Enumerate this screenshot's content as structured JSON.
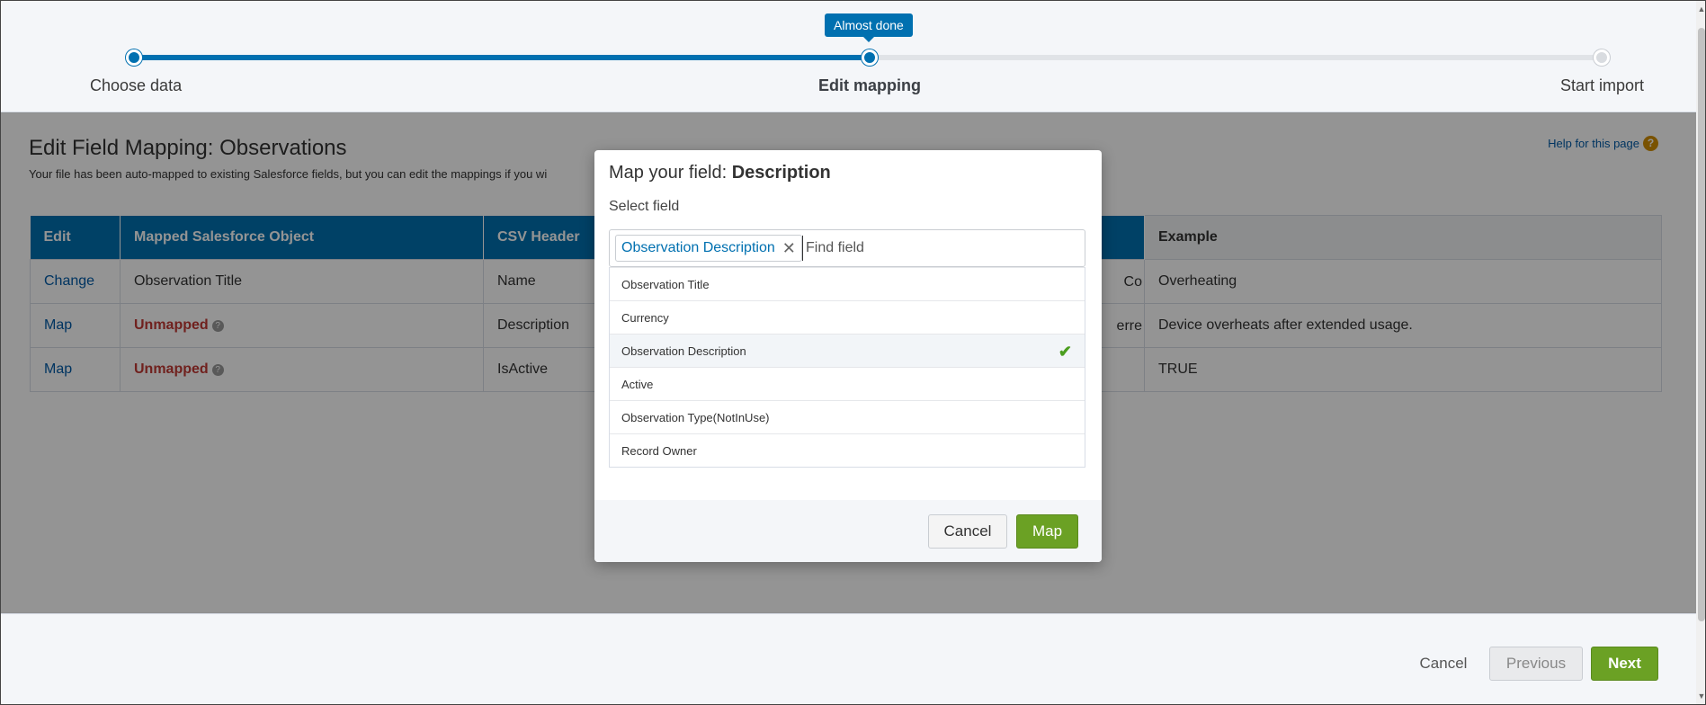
{
  "progress": {
    "bubble": "Almost done",
    "steps": [
      {
        "label": "Choose data",
        "state": "done"
      },
      {
        "label": "Edit mapping",
        "state": "current"
      },
      {
        "label": "Start import",
        "state": "todo"
      }
    ]
  },
  "page": {
    "title": "Edit Field Mapping: Observations",
    "description": "Your file has been auto-mapped to existing Salesforce fields, but you can edit the mappings if you wi",
    "help_link": "Help for this page",
    "help_icon": "question-icon"
  },
  "table": {
    "headers": [
      "Edit",
      "Mapped Salesforce Object",
      "CSV Header",
      "Example"
    ],
    "rows": [
      {
        "edit": "Change",
        "mapped": "Observation Title",
        "csv": "Name",
        "partial": "Co",
        "example": "Overheating"
      },
      {
        "edit": "Map",
        "mapped": "Unmapped",
        "csv": "Description",
        "partial": "erre",
        "example": "Device overheats after extended usage."
      },
      {
        "edit": "Map",
        "mapped": "Unmapped",
        "csv": "IsActive",
        "partial": "",
        "example": "TRUE"
      }
    ]
  },
  "modal": {
    "title_prefix": "Map your field: ",
    "title_field": "Description",
    "subtitle": "Select field",
    "selected_pill": "Observation Description",
    "search_placeholder": "Find field",
    "options": [
      {
        "label": "Observation Title",
        "selected": false
      },
      {
        "label": "Currency",
        "selected": false
      },
      {
        "label": "Observation Description",
        "selected": true
      },
      {
        "label": "Active",
        "selected": false
      },
      {
        "label": "Observation Type(NotInUse)",
        "selected": false
      },
      {
        "label": "Record Owner",
        "selected": false
      }
    ],
    "cancel_label": "Cancel",
    "map_label": "Map"
  },
  "footer": {
    "cancel_label": "Cancel",
    "previous_label": "Previous",
    "next_label": "Next"
  },
  "colors": {
    "brand": "#0070b0",
    "green": "#6ba124",
    "error": "#c23934"
  }
}
